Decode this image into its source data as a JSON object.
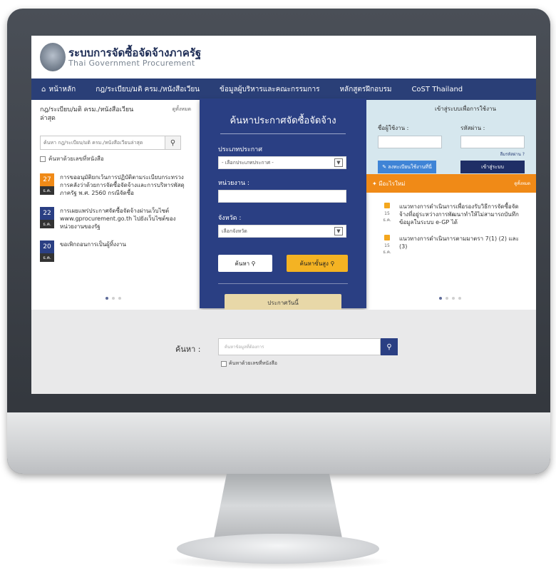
{
  "header": {
    "title": "ระบบการจัดซื้อจัดจ้างภาครัฐ",
    "subtitle": "Thai Government Procurement"
  },
  "nav": {
    "items": [
      {
        "label": "หน้าหลัก",
        "icon": "home-icon"
      },
      {
        "label": "กฎ/ระเบียบ/มติ ครม./หนังสือเวียน"
      },
      {
        "label": "ข้อมูลผู้บริหารและคณะกรรมการ"
      },
      {
        "label": "หลักสูตรฝึกอบรม"
      },
      {
        "label": "CoST Thailand"
      }
    ]
  },
  "left_panel": {
    "heading": "กฎ/ระเบียบ/มติ ครม./หนังสือเวียนล่าสุด",
    "more": "ดูทั้งหมด",
    "search_placeholder": "ค้นหา กฎ/ระเบียบ/มติ ครม./หนังสือเวียนล่าสุด",
    "checkbox_label": "ค้นหาด้วยเลขที่หนังสือ",
    "news": [
      {
        "day": "27",
        "month": "ธ.ค.",
        "day_color": "#f08a17",
        "text": "การขออนุมัติยกเว้นการปฏิบัติตามระเบียบกระทรวงการคลังว่าด้วยการจัดซื้อจัดจ้างและการบริหารพัสดุภาครัฐ พ.ศ. 2560 กรณีจัดซื้อ"
      },
      {
        "day": "22",
        "month": "ธ.ค.",
        "day_color": "#2a3f83",
        "text": "การเผยแพร่ประกาศจัดซื้อจัดจ้างผ่านเว็บไซต์ www.gprocurement.go.th ไปยังเว็บไซต์ของหน่วยงานของรัฐ"
      },
      {
        "day": "20",
        "month": "ธ.ค.",
        "day_color": "#2a3f83",
        "text": "ขอเพิกถอนการเป็นผู้ทิ้งงาน"
      }
    ]
  },
  "center_panel": {
    "title": "ค้นหาประกาศจัดซื้อจัดจ้าง",
    "type_label": "ประเภทประกาศ",
    "type_value": "- เลือกประเภทประกาศ -",
    "agency_label": "หน่วยงาน :",
    "province_label": "จังหวัด :",
    "province_value": "เลือกจังหวัด",
    "search_btn": "ค้นหา",
    "advanced_btn": "ค้นหาขั้นสูง",
    "announce_btn": "ประกาศวันนี้"
  },
  "right_panel": {
    "login_title": "เข้าสู่ระบบเพื่อการใช้งาน",
    "user_label": "ชื่อผู้ใช้งาน :",
    "pass_label": "รหัสผ่าน :",
    "forgot": "ลืมรหัสผ่าน ?",
    "register_btn": "ลงทะเบียนใช้งานที่นี่",
    "login_btn": "เข้าสู่ระบบ",
    "new_title": "มีอะไรใหม่",
    "new_more": "ดูทั้งหมด",
    "news": [
      {
        "date": "15 ธ.ค.",
        "text": "แนวทางการดำเนินการเพื่อรองรับวิธีการจัดซื้อจัดจ้างที่อยู่ระหว่างการพัฒนาทำให้ไม่สามารถบันทึกข้อมูลในระบบ e-GP ได้"
      },
      {
        "date": "15 ธ.ค.",
        "text": "แนวทางการดำเนินการตามมาตรา 7(1) (2) และ (3)"
      }
    ]
  },
  "bottom": {
    "label": "ค้นหา :",
    "placeholder": "ค้นหาข้อมูลที่ต้องการ",
    "checkbox_label": "ค้นหาด้วยเลขที่หนังสือ"
  }
}
